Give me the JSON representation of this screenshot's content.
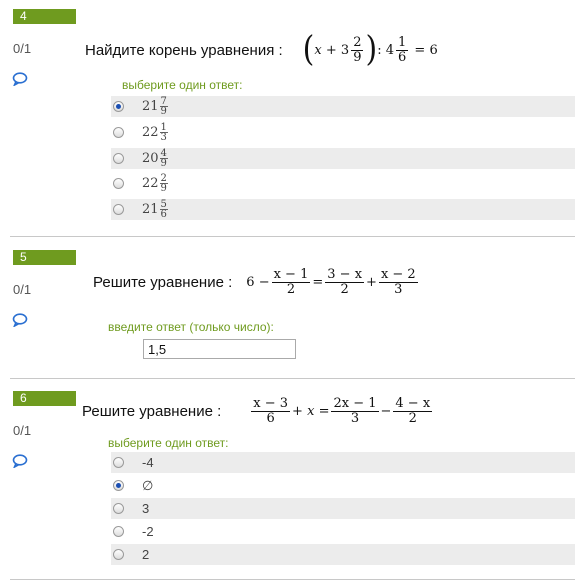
{
  "questions": [
    {
      "number": "4",
      "score": "0/1",
      "statement": "Найдите корень уравнения :",
      "equation": {
        "x": "x",
        "plus": "+",
        "whole": "3",
        "num": "2",
        "den": "9",
        "div": ":",
        "whole2": "4",
        "num2": "1",
        "den2": "6",
        "eq": "=",
        "rhs": "6"
      },
      "prompt": "выберите один ответ:",
      "options": [
        {
          "whole": "21",
          "num": "7",
          "den": "9",
          "selected": true
        },
        {
          "whole": "22",
          "num": "1",
          "den": "3",
          "selected": false
        },
        {
          "whole": "20",
          "num": "4",
          "den": "9",
          "selected": false
        },
        {
          "whole": "22",
          "num": "2",
          "den": "9",
          "selected": false
        },
        {
          "whole": "21",
          "num": "5",
          "den": "6",
          "selected": false
        }
      ]
    },
    {
      "number": "5",
      "score": "0/1",
      "statement": "Решите уравнение :",
      "equation": {
        "a": "6",
        "minus": "−",
        "f1n": "x − 1",
        "f1d": "2",
        "eq": "=",
        "f2n": "3 − x",
        "f2d": "2",
        "plus": "+",
        "f3n": "x − 2",
        "f3d": "3"
      },
      "prompt": "введите ответ (только число):",
      "answer": "1,5"
    },
    {
      "number": "6",
      "score": "0/1",
      "statement": "Решите уравнение :",
      "equation": {
        "f1n": "x − 3",
        "f1d": "6",
        "plus": "+",
        "x": "x",
        "eq": "=",
        "f2n": "2x − 1",
        "f2d": "3",
        "minus": "−",
        "f3n": "4 − x",
        "f3d": "2"
      },
      "prompt": "выберите один ответ:",
      "options": [
        {
          "label": "-4",
          "selected": false
        },
        {
          "label": "∅",
          "selected": true
        },
        {
          "label": "3",
          "selected": false
        },
        {
          "label": "-2",
          "selected": false
        },
        {
          "label": "2",
          "selected": false
        }
      ]
    }
  ],
  "colors": {
    "accent": "#6f9b1f",
    "comment_icon": "#2a6fd1",
    "shade": "#ececec"
  }
}
